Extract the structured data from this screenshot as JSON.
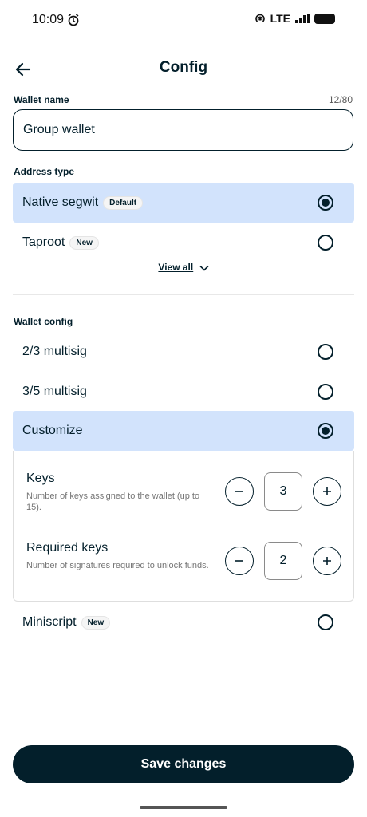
{
  "status_bar": {
    "time": "10:09",
    "network": "LTE",
    "icons": [
      "alarm-icon",
      "hotspot-icon",
      "signal-icon",
      "battery-icon"
    ]
  },
  "header": {
    "title": "Config",
    "back_icon": "arrow-left-icon"
  },
  "wallet_name": {
    "label": "Wallet name",
    "counter": "12/80",
    "value": "Group wallet"
  },
  "address_type": {
    "label": "Address type",
    "options": [
      {
        "label": "Native segwit",
        "badge": "Default",
        "selected": true
      },
      {
        "label": "Taproot",
        "badge": "New",
        "selected": false
      }
    ],
    "view_all": "View all"
  },
  "wallet_config": {
    "label": "Wallet config",
    "options": [
      {
        "label": "2/3 multisig",
        "selected": false
      },
      {
        "label": "3/5 multisig",
        "selected": false
      },
      {
        "label": "Customize",
        "selected": true
      },
      {
        "label": "Miniscript",
        "badge": "New",
        "selected": false
      }
    ],
    "customize": {
      "keys": {
        "title": "Keys",
        "description": "Number of keys assigned to the wallet (up to 15).",
        "value": "3"
      },
      "required_keys": {
        "title": "Required keys",
        "description": "Number of signatures required to unlock funds.",
        "value": "2"
      }
    }
  },
  "save_button": "Save changes",
  "colors": {
    "primary": "#031f2b",
    "selected_bg": "#d2e3fc",
    "muted_text": "#757575"
  }
}
